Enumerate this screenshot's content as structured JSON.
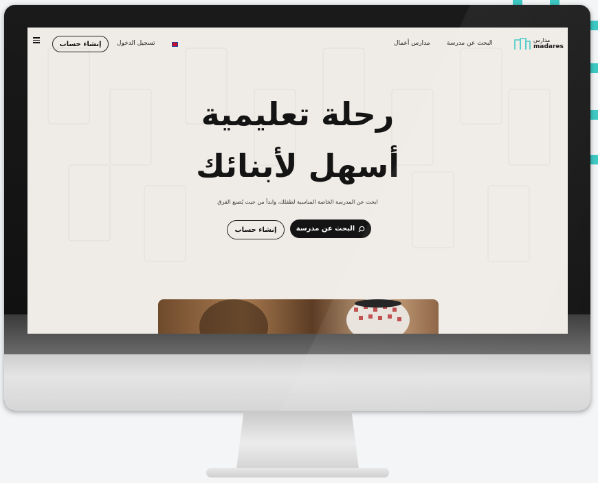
{
  "nav": {
    "logo_ar": "مدارس",
    "logo_en": "madares",
    "links": [
      "البحث عن مدرسة",
      "مدارس أعمال"
    ],
    "login_label": "تسجيل الدخول",
    "signup_label": "إنشاء حساب",
    "language_icon": "uk-flag-icon",
    "menu_icon": "hamburger-menu-icon"
  },
  "hero": {
    "title_line1": "رحلة تعليمية",
    "title_line2": "أسهل لأبنائك",
    "subtitle": "ابحث عن المدرسة الخاصة المناسبة لطفلك، وابدأ من حيث يُصنع الفرق",
    "search_button_label": "البحث عن مدرسة",
    "search_icon": "search-icon",
    "signup_button_label": "إنشاء حساب"
  },
  "colors": {
    "accent": "#3fc9c4",
    "page_bg": "#efebe6",
    "text": "#141414"
  }
}
